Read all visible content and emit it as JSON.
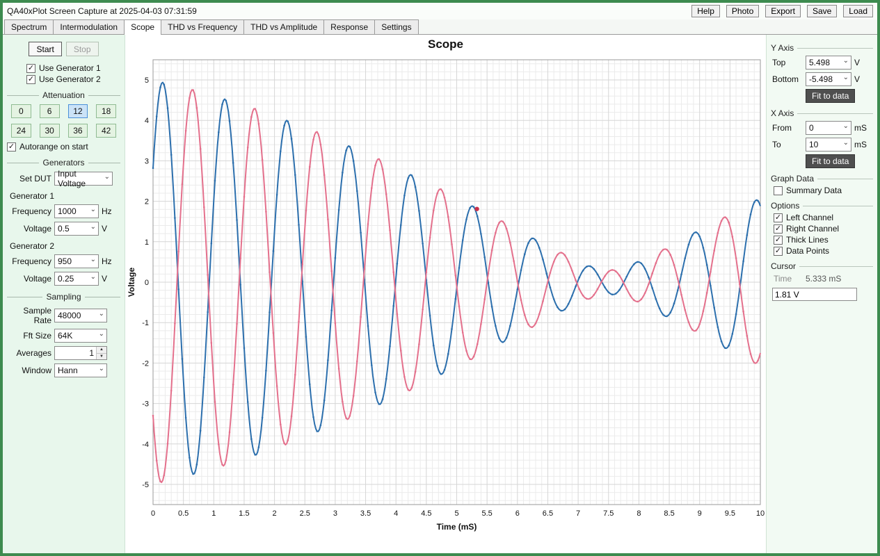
{
  "icons": {
    "chevron_down": "⌄",
    "spin_up": "▲",
    "spin_down": "▼",
    "checkmark": "✓"
  },
  "window": {
    "title": "QA40xPlot Screen Capture at 2025-04-03 07:31:59",
    "titlebar_buttons": [
      "Help",
      "Photo",
      "Export",
      "Save",
      "Load"
    ]
  },
  "tabs": [
    {
      "label": "Spectrum",
      "active": false
    },
    {
      "label": "Intermodulation",
      "active": false
    },
    {
      "label": "Scope",
      "active": true
    },
    {
      "label": "THD vs Frequency",
      "active": false
    },
    {
      "label": "THD vs Amplitude",
      "active": false
    },
    {
      "label": "Response",
      "active": false
    },
    {
      "label": "Settings",
      "active": false
    }
  ],
  "left_panel": {
    "start_button": "Start",
    "stop_button": "Stop",
    "use_generator_1": {
      "label": "Use Generator 1",
      "checked": true
    },
    "use_generator_2": {
      "label": "Use Generator 2",
      "checked": true
    },
    "attenuation": {
      "title": "Attenuation",
      "options": [
        "0",
        "6",
        "12",
        "18",
        "24",
        "30",
        "36",
        "42"
      ],
      "selected": "12"
    },
    "autorange": {
      "label": "Autorange on start",
      "checked": true
    },
    "generators": {
      "title": "Generators",
      "set_dut": {
        "label": "Set DUT",
        "value": "Input Voltage"
      },
      "generator1": {
        "title": "Generator 1",
        "frequency": {
          "label": "Frequency",
          "value": "1000",
          "unit": "Hz"
        },
        "voltage": {
          "label": "Voltage",
          "value": "0.5",
          "unit": "V"
        }
      },
      "generator2": {
        "title": "Generator 2",
        "frequency": {
          "label": "Frequency",
          "value": "950",
          "unit": "Hz"
        },
        "voltage": {
          "label": "Voltage",
          "value": "0.25",
          "unit": "V"
        }
      }
    },
    "sampling": {
      "title": "Sampling",
      "sample_rate": {
        "label": "Sample Rate",
        "value": "48000"
      },
      "fft_size": {
        "label": "Fft Size",
        "value": "64K"
      },
      "averages": {
        "label": "Averages",
        "value": "1"
      },
      "window": {
        "label": "Window",
        "value": "Hann"
      }
    }
  },
  "right_panel": {
    "y_axis": {
      "title": "Y Axis",
      "top": {
        "label": "Top",
        "value": "5.498",
        "unit": "V"
      },
      "bottom": {
        "label": "Bottom",
        "value": "-5.498",
        "unit": "V"
      },
      "fit_button": "Fit to data"
    },
    "x_axis": {
      "title": "X Axis",
      "from": {
        "label": "From",
        "value": "0",
        "unit": "mS"
      },
      "to": {
        "label": "To",
        "value": "10",
        "unit": "mS"
      },
      "fit_button": "Fit to data"
    },
    "graph_data": {
      "title": "Graph Data",
      "summary": {
        "label": "Summary Data",
        "checked": false
      }
    },
    "options": {
      "title": "Options",
      "items": [
        {
          "label": "Left Channel",
          "checked": true
        },
        {
          "label": "Right Channel",
          "checked": true
        },
        {
          "label": "Thick Lines",
          "checked": true
        },
        {
          "label": "Data Points",
          "checked": true
        }
      ]
    },
    "cursor": {
      "title": "Cursor",
      "time_label": "Time",
      "time_value": "5.333 mS",
      "value": "1.81 V"
    }
  },
  "chart_data": {
    "type": "line",
    "title": "Scope",
    "xlabel": "Time (mS)",
    "ylabel": "Voltage",
    "xlim": [
      0,
      10
    ],
    "ylim": [
      -5.498,
      5.498
    ],
    "x_major_step": 0.5,
    "x_minor_step": 0.1,
    "y_major_step": 1,
    "y_minor_step": 0.2,
    "grid": true,
    "description": "Two-tone beat waveform: each channel is the sum of Generator 1 (1000 Hz) and Generator 2 (950 Hz); envelope decays from ~5 V near 0 mS to a node near 7.5 mS then regrows to ~2 V at 10 mS",
    "series": [
      {
        "name": "Left Channel",
        "color": "#2c6fad",
        "components": [
          {
            "freq_hz": 1000,
            "amp": 2.85,
            "phase": 0.97
          },
          {
            "freq_hz": 950,
            "amp": 2.55,
            "phase": 0.185
          }
        ]
      },
      {
        "name": "Right Channel",
        "color": "#e4708c",
        "components": [
          {
            "freq_hz": 1000,
            "amp": 2.85,
            "phase": 4.23
          },
          {
            "freq_hz": 950,
            "amp": 2.55,
            "phase": 3.45
          }
        ]
      }
    ],
    "cursor_point": {
      "x": 5.333,
      "y": 1.81,
      "color": "#c9304a"
    }
  }
}
